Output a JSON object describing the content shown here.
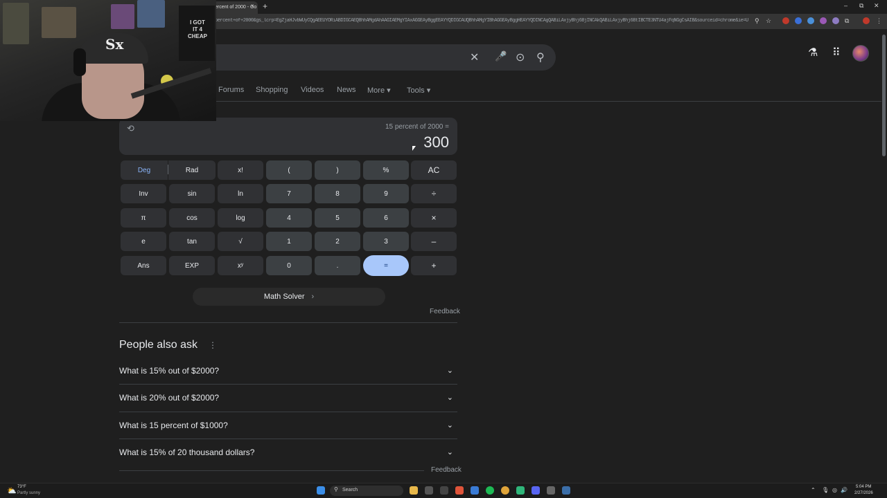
{
  "browser": {
    "tab_title": "ercent of 2000 - Go",
    "tab_close": "×",
    "new_tab": "+",
    "url": "percent+of+2000&gs_lcrp=EgZjaHJvbWUyCQgAEEUYORiABDIGCAEQBhhAMgdAhAAGIAEMgYIAxAGGEAyBggEEAYYQDIGCAUQBhhAMgYIBhAGGEAyBggHEAYYQDINCAgQABiLAxjyBhj6BjINCAkQABiLAxjyBhj6BtIBCTE3NTU4ajFqNGgCsAIB&sourceid=chrome&ie=UTF-8",
    "window_controls": [
      "–",
      "⧉",
      "✕"
    ]
  },
  "webcam": {
    "shirt_text": "I GOT IT 4 CHEAP",
    "cap_logo": "Sx"
  },
  "search": {
    "clear_icon": "✕",
    "mic_icon": "🎤",
    "lens_icon": "⊙",
    "search_icon": "⚲"
  },
  "header_right": {
    "labs_icon": "⚗",
    "apps_icon": "⋮⋮⋮"
  },
  "nav": {
    "items": [
      "Forums",
      "Shopping",
      "Videos",
      "News",
      "More",
      "Tools"
    ],
    "dropdown_caret": "▾"
  },
  "calculator": {
    "history_icon": "⟲",
    "expression": "15 percent of 2000 =",
    "result": "300",
    "rows": [
      [
        "Deg",
        "Rad",
        "x!",
        "(",
        ")",
        "%",
        "AC"
      ],
      [
        "Inv",
        "sin",
        "ln",
        "7",
        "8",
        "9",
        "÷"
      ],
      [
        "π",
        "cos",
        "log",
        "4",
        "5",
        "6",
        "×"
      ],
      [
        "e",
        "tan",
        "√",
        "1",
        "2",
        "3",
        "–"
      ],
      [
        "Ans",
        "EXP",
        "xʸ",
        "0",
        ".",
        "=",
        "+"
      ]
    ]
  },
  "math_solver": {
    "label": "Math Solver",
    "chevron": "›"
  },
  "feedback_label": "Feedback",
  "people_also_ask": {
    "title": "People also ask",
    "more_icon": "⋮",
    "chevron": "⌄",
    "questions": [
      "What is 15% out of $2000?",
      "What is 20% out of $2000?",
      "What is 15 percent of $1000?",
      "What is 15% of 20 thousand dollars?"
    ]
  },
  "taskbar": {
    "weather_icon": "⛅",
    "weather_temp": "73°F",
    "weather_cond": "Partly sunny",
    "search_label": "Search",
    "search_icon": "⚲",
    "tray_icons": [
      "⌃",
      "🎙",
      "◎",
      "🔊",
      "🔋"
    ],
    "clock_time": "5:04 PM",
    "clock_date": "2/27/2026"
  },
  "colors": {
    "background": "#1f1f1f",
    "equals_key": "#a8c7fa",
    "deg_active": "#8ab4f8"
  }
}
